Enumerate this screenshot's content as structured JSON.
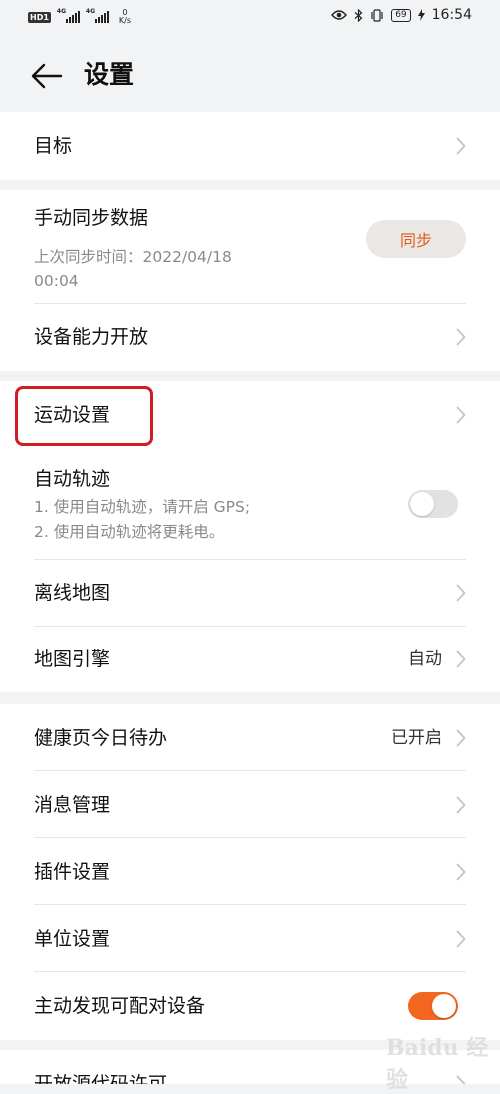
{
  "status_bar": {
    "hd": "HD",
    "sim1": "1",
    "network1": "4G",
    "network2": "4G",
    "speed_value": "0",
    "speed_unit": "K/s",
    "battery": "69",
    "time": "16:54"
  },
  "header": {
    "title": "设置"
  },
  "goal": {
    "label": "目标"
  },
  "sync": {
    "title": "手动同步数据",
    "last_sync_line1": "上次同步时间：2022/04/18",
    "last_sync_line2": "00:04",
    "button": "同步"
  },
  "device_capability": {
    "label": "设备能力开放"
  },
  "sport": {
    "settings": "运动设置",
    "auto_track_title": "自动轨迹",
    "auto_track_desc1": "1. 使用自动轨迹，请开启 GPS;",
    "auto_track_desc2": "2. 使用自动轨迹将更耗电。",
    "auto_track_enabled": false,
    "offline_map": "离线地图",
    "map_engine": "地图引擎",
    "map_engine_value": "自动"
  },
  "general": {
    "health_todo": "健康页今日待办",
    "health_todo_value": "已开启",
    "message_manage": "消息管理",
    "plugin_settings": "插件设置",
    "unit_settings": "单位设置",
    "discover_devices": "主动发现可配对设备",
    "discover_devices_enabled": true
  },
  "partial": {
    "open_source": "开放源代码许可"
  },
  "watermark": "Baidu 经验",
  "colors": {
    "accent": "#f3661f",
    "sync_text": "#e25a1e",
    "highlight": "#d01d24"
  }
}
